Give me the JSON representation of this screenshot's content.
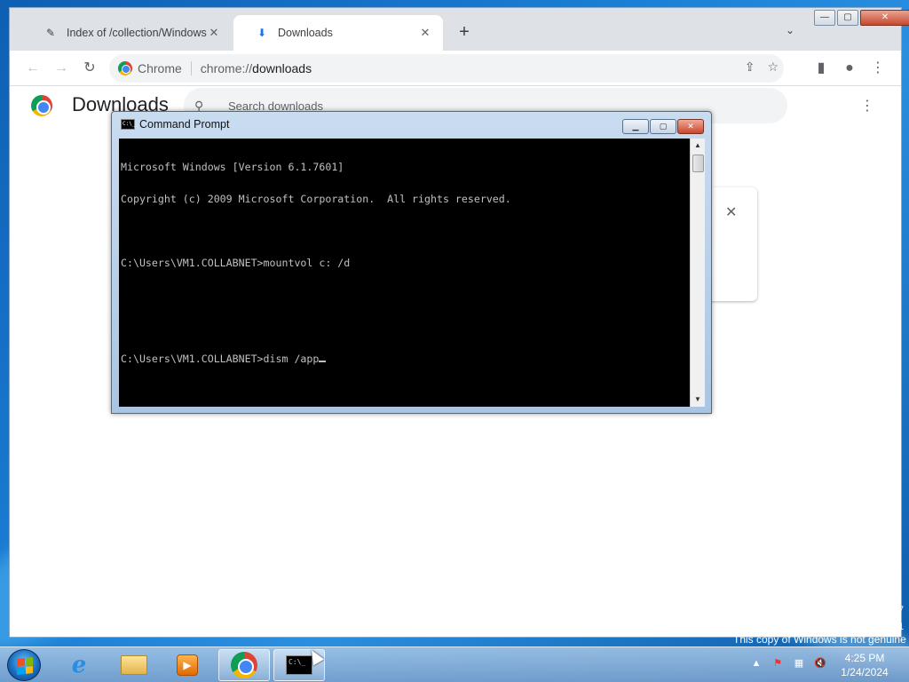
{
  "browser": {
    "tabs": [
      {
        "title": "Index of /collection/Windows 7/",
        "close": "✕"
      },
      {
        "title": "Downloads",
        "close": "✕"
      }
    ],
    "new_tab": "+",
    "tab_list": "⌄",
    "window_buttons": {
      "minimize": "—",
      "maximize": "▢",
      "close": "✕"
    },
    "toolbar": {
      "back": "←",
      "forward": "→",
      "reload": "↻"
    },
    "omnibox": {
      "chip_label": "Chrome",
      "url_scheme": "chrome://",
      "url_path": "downloads"
    },
    "omni_icons": {
      "share": "⇪",
      "bookmark": "☆"
    },
    "side_panel": "▮",
    "profile": "●",
    "menu": "⋮"
  },
  "downloads": {
    "title": "Downloads",
    "search_placeholder": "Search downloads",
    "menu": "⋮",
    "card_close": "✕"
  },
  "cmd": {
    "title": "Command Prompt",
    "icon_text": "C:\\_",
    "buttons": {
      "minimize": "▁",
      "maximize": "▢",
      "close": "✕"
    },
    "lines": [
      "Microsoft Windows [Version 6.1.7601]",
      "Copyright (c) 2009 Microsoft Corporation.  All rights reserved.",
      "",
      "C:\\Users\\VM1.COLLABNET>mountvol c: /d",
      "",
      "",
      "C:\\Users\\VM1.COLLABNET>dism /app"
    ],
    "scroll_up": "▲",
    "scroll_down": "▼"
  },
  "desktop": {
    "genuine_notice": "This copy of Windows is not genuine",
    "side_numbers": [
      "7",
      "1"
    ]
  },
  "taskbar": {
    "ie_glyph": "e",
    "media_glyph": "▶",
    "cmd_glyph": "C:\\_",
    "tray": {
      "show_hidden": "▲",
      "flag": "⚑",
      "network": "▦",
      "volume": "🔇"
    },
    "clock": {
      "time": "4:25 PM",
      "date": "1/24/2024"
    }
  }
}
